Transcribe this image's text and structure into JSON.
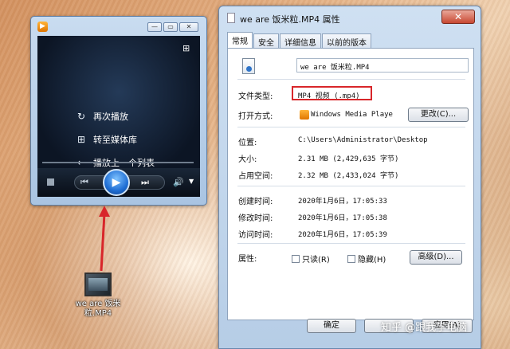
{
  "wmp": {
    "menu": [
      {
        "icon": "replay-icon",
        "label": "再次播放"
      },
      {
        "icon": "switch-library-icon",
        "label": "转至媒体库"
      },
      {
        "icon": "back-arrow-icon",
        "label": "播放上一个列表"
      }
    ]
  },
  "desktop_icon": {
    "label": "we are 饭米粒.MP4"
  },
  "dialog": {
    "title": "we are 饭米粒.MP4 属性",
    "close_label": "✕",
    "tabs": [
      "常规",
      "安全",
      "详细信息",
      "以前的版本"
    ],
    "filename": "we are 饭米粒.MP4",
    "file_type_label": "文件类型:",
    "file_type_value": "MP4 视频 (.mp4)",
    "open_with_label": "打开方式:",
    "open_with_value": "Windows Media Playe",
    "change_button": "更改(C)...",
    "location_label": "位置:",
    "location_value": "C:\\Users\\Administrator\\Desktop",
    "size_label": "大小:",
    "size_value": "2.31 MB (2,429,635 字节)",
    "disk_size_label": "占用空间:",
    "disk_size_value": "2.32 MB (2,433,024 字节)",
    "created_label": "创建时间:",
    "created_value": "2020年1月6日，17:05:33",
    "modified_label": "修改时间:",
    "modified_value": "2020年1月6日，17:05:38",
    "accessed_label": "访问时间:",
    "accessed_value": "2020年1月6日，17:05:39",
    "attributes_label": "属性:",
    "readonly_label": "只读(R)",
    "hidden_label": "隐藏(H)",
    "advanced_button": "高级(D)...",
    "ok_button": "确定",
    "apply_button": "应用(A)"
  },
  "watermark": "知乎 @跟我学电脑",
  "colors": {
    "highlight": "#d8262a"
  }
}
